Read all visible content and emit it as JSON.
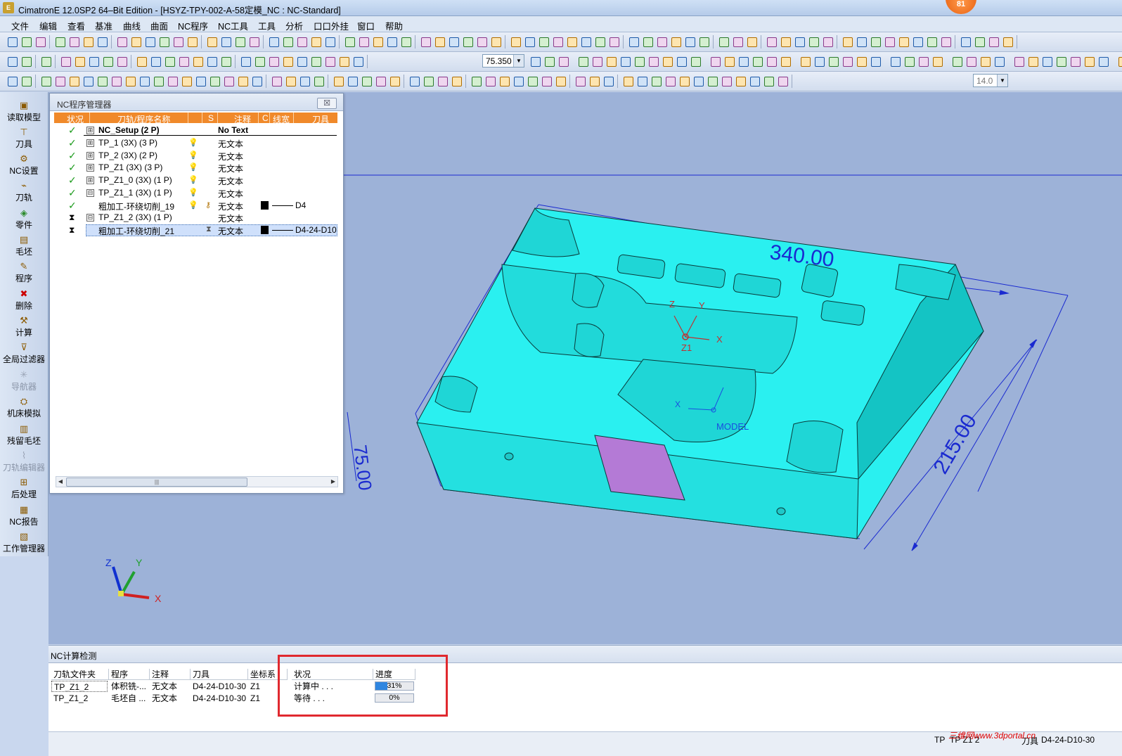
{
  "window": {
    "title": "CimatronE 12.0SP2  64–Bit Edition - [HSYZ-TPY-002-A-58定模_NC : NC-Standard]",
    "logo": "E",
    "badge": "81"
  },
  "menu": [
    "文件",
    "编辑",
    "查看",
    "基准",
    "曲线",
    "曲面",
    "NC程序",
    "NC工具",
    "工具",
    "分析",
    "口口外挂",
    "窗口",
    "帮助"
  ],
  "toolbar": {
    "zoom_value": "75.350",
    "line_width_value": "14.0"
  },
  "left_panel": [
    {
      "label": "读取模型",
      "icon": "folder-icon",
      "enabled": true
    },
    {
      "label": "刀具",
      "icon": "tool-icon",
      "enabled": true
    },
    {
      "label": "NC设置",
      "icon": "nc-setup-icon",
      "enabled": true
    },
    {
      "label": "刀轨",
      "icon": "toolpath-icon",
      "enabled": true
    },
    {
      "label": "零件",
      "icon": "part-icon",
      "enabled": true
    },
    {
      "label": "毛坯",
      "icon": "stock-icon",
      "enabled": true
    },
    {
      "label": "程序",
      "icon": "procedure-icon",
      "enabled": true
    },
    {
      "label": "删除",
      "icon": "delete-icon",
      "enabled": true
    },
    {
      "label": "计算",
      "icon": "execute-icon",
      "enabled": true
    },
    {
      "label": "全局过滤器",
      "icon": "filter-icon",
      "enabled": true
    },
    {
      "label": "导航器",
      "icon": "navigator-icon",
      "enabled": false
    },
    {
      "label": "机床模拟",
      "icon": "simulator-icon",
      "enabled": true
    },
    {
      "label": "残留毛坯",
      "icon": "rest-stock-icon",
      "enabled": true
    },
    {
      "label": "刀轨编辑器",
      "icon": "tp-editor-icon",
      "enabled": false
    },
    {
      "label": "后处理",
      "icon": "post-icon",
      "enabled": true
    },
    {
      "label": "NC报告",
      "icon": "report-icon",
      "enabled": true
    },
    {
      "label": "工作管理器",
      "icon": "job-manager-icon",
      "enabled": true
    }
  ],
  "nc_manager": {
    "title": "NC程序管理器",
    "close": "☒",
    "columns": [
      "状况",
      "刀轨/程序名称",
      "S",
      "注释",
      "C",
      "线宽",
      "刀具"
    ],
    "rows": [
      {
        "status": "setup",
        "expand": "⊞",
        "name": "NC_Setup (2 P)",
        "s": "",
        "comment": "No Text",
        "tool": "",
        "bold": true
      },
      {
        "status": "done",
        "expand": "⊞",
        "name": "TP_1 (3X) (3 P)",
        "s": "bulb",
        "comment": "无文本",
        "tool": ""
      },
      {
        "status": "done",
        "expand": "⊞",
        "name": "TP_2 (3X) (2 P)",
        "s": "bulb",
        "comment": "无文本",
        "tool": ""
      },
      {
        "status": "done",
        "expand": "⊞",
        "name": "TP_Z1 (3X) (3 P)",
        "s": "bulb",
        "comment": "无文本",
        "tool": ""
      },
      {
        "status": "done",
        "expand": "⊞",
        "name": "TP_Z1_0 (3X) (1 P)",
        "s": "bulb",
        "comment": "无文本",
        "tool": ""
      },
      {
        "status": "done",
        "expand": "⊟",
        "name": "TP_Z1_1 (3X) (1 P)",
        "s": "bulb",
        "comment": "无文本",
        "tool": ""
      },
      {
        "status": "done",
        "expand": "",
        "name": "粗加工-环绕切削_19",
        "s": "bulb",
        "comment": "无文本",
        "tool": "D4"
      },
      {
        "status": "wait",
        "expand": "⊟",
        "name": "TP_Z1_2 (3X) (1 P)",
        "s": "",
        "comment": "无文本",
        "tool": ""
      },
      {
        "status": "wait",
        "expand": "",
        "name": "粗加工-环绕切削_21",
        "s": "hourglass",
        "comment": "无文本",
        "tool": "D4-24-D10",
        "selected": true
      }
    ]
  },
  "viewport": {
    "dims": [
      "340.00",
      "215.00",
      "75.00"
    ],
    "part_axes": {
      "x": "X",
      "y": "Y",
      "z": "Z",
      "origin": "Z1"
    },
    "model_label": "MODEL",
    "triad": {
      "x": "X",
      "y": "Y",
      "z": "Z"
    },
    "colors": {
      "bg": "#9db2d8",
      "part": "#28ecec",
      "part_dark": "#10c8c8",
      "highlight": "#b47ad6",
      "dim": "#1a2ad0"
    }
  },
  "nc_calc": {
    "title": "NC计算检测",
    "columns": [
      "刀轨文件夹",
      "程序",
      "注释",
      "刀具",
      "坐标系",
      "状况",
      "进度"
    ],
    "rows": [
      {
        "toolpath": "TP_Z1_2",
        "procedure": "体积铣-...",
        "comment": "无文本",
        "tool": "D4-24-D10-30",
        "ucs": "Z1",
        "status": "计算中 . . .",
        "progress": 31,
        "progress_label": "31%"
      },
      {
        "toolpath": "TP_Z1_2",
        "procedure": "毛坯自 ...",
        "comment": "无文本",
        "tool": "D4-24-D10-30",
        "ucs": "Z1",
        "status": "等待 . . .",
        "progress": 0,
        "progress_label": "0%"
      }
    ]
  },
  "statusbar": {
    "tp_label": "TP",
    "tp_value": "TP Z1 2",
    "tool_label": "刀具",
    "tool_value": "D4-24-D10-30",
    "watermark": "三维网www.3dportal.cn"
  }
}
